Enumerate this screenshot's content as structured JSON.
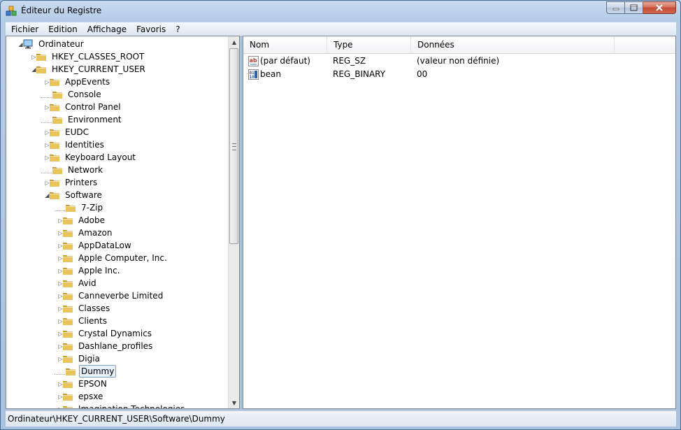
{
  "window": {
    "title": "Éditeur du Registre"
  },
  "menu": [
    "Fichier",
    "Edition",
    "Affichage",
    "Favoris",
    "?"
  ],
  "tree": [
    {
      "label": "Ordinateur",
      "level": 0,
      "state": "expanded",
      "kind": "computer"
    },
    {
      "label": "HKEY_CLASSES_ROOT",
      "level": 1,
      "state": "collapsed"
    },
    {
      "label": "HKEY_CURRENT_USER",
      "level": 1,
      "state": "expanded"
    },
    {
      "label": "AppEvents",
      "level": 2,
      "state": "collapsed"
    },
    {
      "label": "Console",
      "level": 2,
      "state": "none"
    },
    {
      "label": "Control Panel",
      "level": 2,
      "state": "collapsed"
    },
    {
      "label": "Environment",
      "level": 2,
      "state": "none"
    },
    {
      "label": "EUDC",
      "level": 2,
      "state": "collapsed"
    },
    {
      "label": "Identities",
      "level": 2,
      "state": "collapsed"
    },
    {
      "label": "Keyboard Layout",
      "level": 2,
      "state": "collapsed"
    },
    {
      "label": "Network",
      "level": 2,
      "state": "none"
    },
    {
      "label": "Printers",
      "level": 2,
      "state": "collapsed"
    },
    {
      "label": "Software",
      "level": 2,
      "state": "expanded"
    },
    {
      "label": "7-Zip",
      "level": 3,
      "state": "none"
    },
    {
      "label": "Adobe",
      "level": 3,
      "state": "collapsed"
    },
    {
      "label": "Amazon",
      "level": 3,
      "state": "collapsed"
    },
    {
      "label": "AppDataLow",
      "level": 3,
      "state": "collapsed"
    },
    {
      "label": "Apple Computer, Inc.",
      "level": 3,
      "state": "collapsed"
    },
    {
      "label": "Apple Inc.",
      "level": 3,
      "state": "collapsed"
    },
    {
      "label": "Avid",
      "level": 3,
      "state": "collapsed"
    },
    {
      "label": "Canneverbe Limited",
      "level": 3,
      "state": "collapsed"
    },
    {
      "label": "Classes",
      "level": 3,
      "state": "collapsed"
    },
    {
      "label": "Clients",
      "level": 3,
      "state": "collapsed"
    },
    {
      "label": "Crystal Dynamics",
      "level": 3,
      "state": "collapsed"
    },
    {
      "label": "Dashlane_profiles",
      "level": 3,
      "state": "collapsed"
    },
    {
      "label": "Digia",
      "level": 3,
      "state": "collapsed"
    },
    {
      "label": "Dummy",
      "level": 3,
      "state": "none",
      "selected": true
    },
    {
      "label": "EPSON",
      "level": 3,
      "state": "collapsed"
    },
    {
      "label": "epsxe",
      "level": 3,
      "state": "collapsed"
    },
    {
      "label": "Imagination Technologies",
      "level": 3,
      "state": "collapsed"
    }
  ],
  "list": {
    "columns": [
      "Nom",
      "Type",
      "Données"
    ],
    "rows": [
      {
        "name": "(par défaut)",
        "type": "REG_SZ",
        "data": "(valeur non définie)",
        "icon": "string-value-icon"
      },
      {
        "name": "bean",
        "type": "REG_BINARY",
        "data": "00",
        "icon": "binary-value-icon"
      }
    ]
  },
  "status": {
    "path": "Ordinateur\\HKEY_CURRENT_USER\\Software\\Dummy"
  },
  "colors": {
    "folder": "#e8c45a",
    "folder_dark": "#c99a2e",
    "selection_border": "#7da2ce",
    "selection_fill": "#e5f1fb"
  }
}
